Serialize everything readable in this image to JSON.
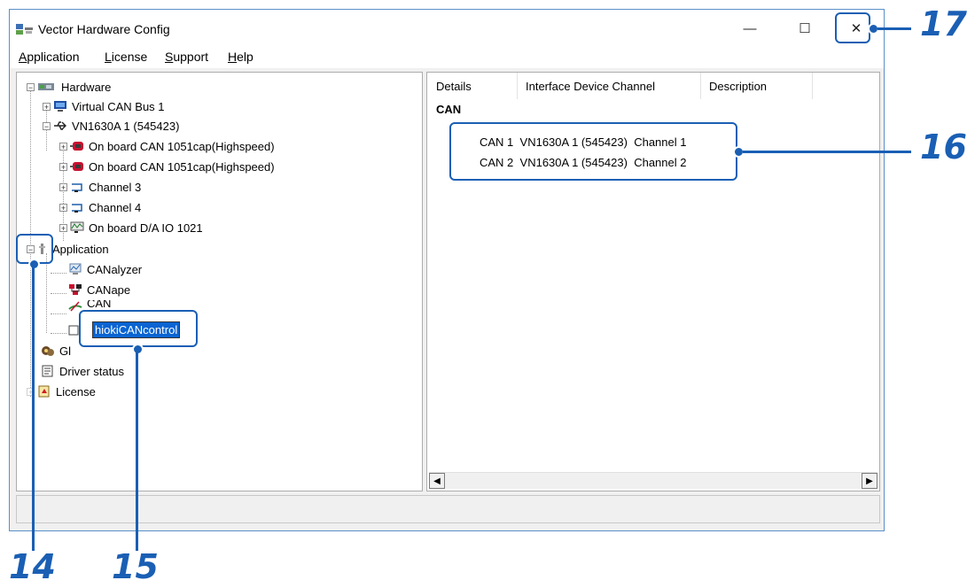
{
  "window": {
    "title": "Vector Hardware Config",
    "controls": {
      "minimize": "—",
      "maximize": "☐",
      "close": "✕"
    }
  },
  "menu": [
    "Application",
    "License",
    "Support",
    "Help"
  ],
  "tree": {
    "hardware": "Hardware",
    "virtual_can_bus": "Virtual CAN Bus 1",
    "vn1630a": "VN1630A 1 (545423)",
    "onboard_can_1": "On board CAN 1051cap(Highspeed)",
    "onboard_can_2": "On board CAN 1051cap(Highspeed)",
    "channel3": "Channel 3",
    "channel4": "Channel 4",
    "onboard_da": "On board D/A IO 1021",
    "application": "Application",
    "canalyzer": "CANalyzer",
    "canape": "CANape",
    "canoe_partial": "CAN",
    "editing_label": "hiokiCANcontrol",
    "global_settings_partial": "Gl",
    "driver_status": "Driver status",
    "license": "License"
  },
  "details": {
    "columns": [
      "Details",
      "Interface Device Channel",
      "Description"
    ],
    "group": "CAN",
    "channels": [
      {
        "name": "CAN 1",
        "device": "VN1630A 1 (545423)",
        "channel": "Channel 1"
      },
      {
        "name": "CAN 2",
        "device": "VN1630A 1 (545423)",
        "channel": "Channel 2"
      }
    ]
  },
  "callouts": {
    "c14": "14",
    "c15": "15",
    "c16": "16",
    "c17": "17"
  },
  "colors": {
    "callout": "#1a5fb4",
    "selection": "#0a64d2"
  },
  "icons": {
    "app": "hardware-config-icon",
    "hardware": "hardware-icon",
    "virtual_bus": "monitor-icon",
    "usb": "usb-icon",
    "can_port": "red-can-port-icon",
    "channel": "channel-connector-icon",
    "da_io": "da-io-icon",
    "application": "application-icon",
    "canalyzer": "canalyzer-icon",
    "canape": "canape-icon",
    "canoe": "canoe-icon",
    "blank_app": "blank-app-icon",
    "global": "global-settings-icon",
    "driver": "driver-status-icon",
    "license": "license-icon"
  }
}
